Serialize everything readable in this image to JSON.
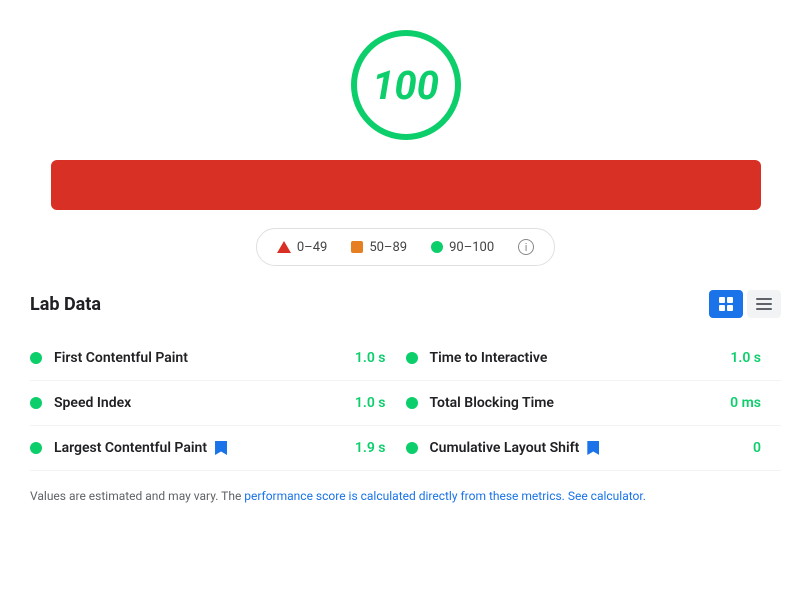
{
  "score": {
    "value": "100",
    "color": "#0cce6b"
  },
  "legend": {
    "range1": "0–49",
    "range2": "50–89",
    "range3": "90–100"
  },
  "labData": {
    "title": "Lab Data",
    "metrics": [
      {
        "col": 1,
        "name": "First Contentful Paint",
        "value": "1.0 s",
        "bookmark": false
      },
      {
        "col": 2,
        "name": "Time to Interactive",
        "value": "1.0 s",
        "bookmark": false
      },
      {
        "col": 1,
        "name": "Speed Index",
        "value": "1.0 s",
        "bookmark": false
      },
      {
        "col": 2,
        "name": "Total Blocking Time",
        "value": "0 ms",
        "bookmark": false
      },
      {
        "col": 1,
        "name": "Largest Contentful Paint",
        "value": "1.9 s",
        "bookmark": true
      },
      {
        "col": 2,
        "name": "Cumulative Layout Shift",
        "value": "0",
        "bookmark": true
      }
    ]
  },
  "footer": {
    "text": "Values are estimated and may vary. The ",
    "link1_text": "performance score is calculated directly from these metrics.",
    "link1_href": "#",
    "text2": " ",
    "link2_text": "See calculator.",
    "link2_href": "#"
  }
}
